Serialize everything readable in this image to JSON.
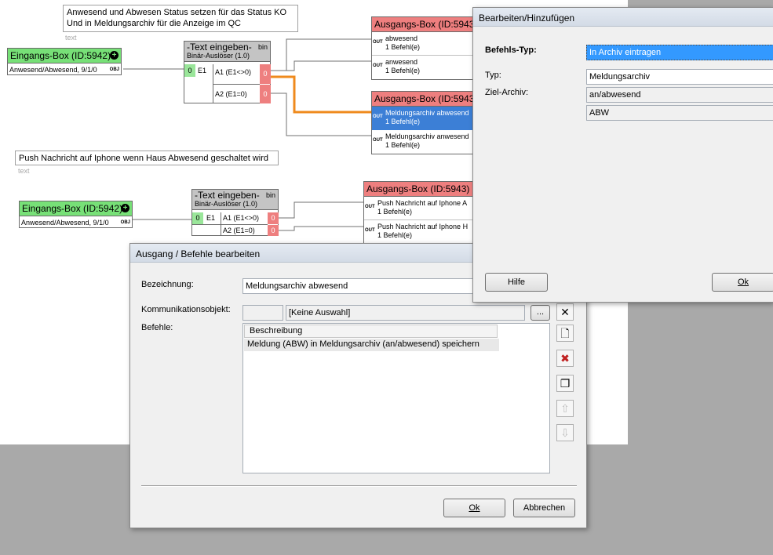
{
  "canvas": {
    "note1": {
      "text": "Anwesend und Abwesen Status setzen für das Status KO\nUnd in Meldungsarchiv für die Anzeige im QC",
      "sub": "text"
    },
    "note2": {
      "text": "Push Nachricht auf Iphone wenn Haus Abwesend geschaltet wird",
      "sub": "text"
    },
    "input_box_1": {
      "title": "Eingangs-Box (ID:5942)",
      "row": "Anwesend/Abwesend, 9/1/0",
      "port": "OBJ"
    },
    "input_box_2": {
      "title": "Eingangs-Box (ID:5942)",
      "row": "Anwesend/Abwesend, 9/1/0",
      "port": "OBJ"
    },
    "text_box_1": {
      "title": "-Text eingeben-",
      "subtitle": "Binär-Auslöser (1.0)",
      "bin": "bin",
      "in_num": "0",
      "in_label": "E1",
      "out1": "A1 (E1<>0)",
      "out2": "A2 (E1=0)",
      "out1_num": "0",
      "out2_num": "0"
    },
    "text_box_2": {
      "title": "-Text eingeben-",
      "subtitle": "Binär-Auslöser (1.0)",
      "bin": "bin",
      "in_num": "0",
      "in_label": "E1",
      "out1": "A1 (E1<>0)",
      "out2": "A2 (E1=0)",
      "out1_num": "0",
      "out2_num": "0"
    },
    "output_box_1": {
      "title": "Ausgangs-Box (ID:5943)",
      "rows": [
        {
          "line1": "abwesend",
          "line2": "1 Befehl(e)",
          "port": "OUT"
        },
        {
          "line1": "anwesend",
          "line2": "1 Befehl(e)",
          "port": "OUT"
        }
      ]
    },
    "output_box_2": {
      "title": "Ausgangs-Box (ID:5943)",
      "rows": [
        {
          "line1": "Meldungsarchiv abwesend",
          "line2": "1 Befehl(e)",
          "port": "OUT"
        },
        {
          "line1": "Meldungsarchiv anwesend",
          "line2": "1 Befehl(e)",
          "port": "OUT"
        }
      ]
    },
    "output_box_3": {
      "title": "Ausgangs-Box (ID:5943)",
      "rows": [
        {
          "line1": "Push Nachricht auf Iphone A",
          "line2": "1 Befehl(e)",
          "port": "OUT"
        },
        {
          "line1": "Push Nachricht auf Iphone H",
          "line2": "1 Befehl(e)",
          "port": "OUT"
        }
      ]
    }
  },
  "dialog_ausgang": {
    "title": "Ausgang / Befehle bearbeiten",
    "bezeichnung_label": "Bezeichnung:",
    "bezeichnung_value": "Meldungsarchiv abwesend",
    "komm_label": "Kommunikationsobjekt:",
    "komm_value": "[Keine Auswahl]",
    "browse_label": "...",
    "befehle_label": "Befehle:",
    "table_header": "Beschreibung",
    "table_rows": [
      "Meldung (ABW) in Meldungsarchiv (an/abwesend) speichern"
    ],
    "ok_label": "Ok",
    "cancel_label": "Abbrechen"
  },
  "dialog_bearbeiten": {
    "title": "Bearbeiten/Hinzufügen",
    "befehlstyp_label": "Befehls-Typ:",
    "befehlstyp_value": "In Archiv eintragen",
    "typ_label": "Typ:",
    "typ_value": "Meldungsarchiv",
    "zielarchiv_label": "Ziel-Archiv:",
    "zielarchiv_value": "an/abwesend",
    "text_value": "ABW",
    "hilfe_label": "Hilfe",
    "ok_label": "Ok"
  },
  "colors": {
    "input_green": "#77e077",
    "output_red": "#ee7f7f",
    "selection_blue": "#3c7fd6",
    "wire_orange": "#ef8a1c"
  }
}
